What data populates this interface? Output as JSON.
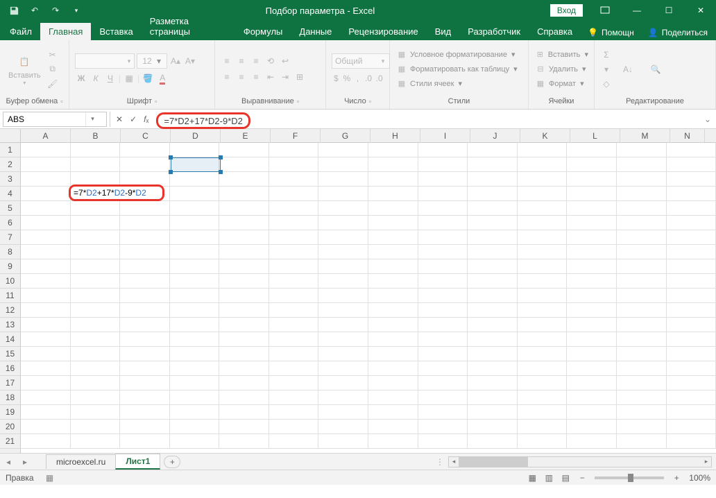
{
  "titlebar": {
    "title": "Подбор параметра - Excel",
    "login": "Вход"
  },
  "tabs": [
    "Файл",
    "Главная",
    "Вставка",
    "Разметка страницы",
    "Формулы",
    "Данные",
    "Рецензирование",
    "Вид",
    "Разработчик",
    "Справка"
  ],
  "active_tab_index": 1,
  "ribbon_right": {
    "tell": "Помощн",
    "share": "Поделиться"
  },
  "ribbon_groups": {
    "clipboard": {
      "paste": "Вставить",
      "label": "Буфер обмена"
    },
    "font": {
      "name": "",
      "size": "12",
      "label": "Шрифт",
      "buttons": [
        "Ж",
        "К",
        "Ч"
      ]
    },
    "alignment": {
      "label": "Выравнивание"
    },
    "number": {
      "format": "Общий",
      "label": "Число"
    },
    "styles": {
      "cond": "Условное форматирование",
      "table": "Форматировать как таблицу",
      "cell": "Стили ячеек",
      "label": "Стили"
    },
    "cells": {
      "insert": "Вставить",
      "delete": "Удалить",
      "format": "Формат",
      "label": "Ячейки"
    },
    "editing": {
      "label": "Редактирование"
    }
  },
  "namebox": "ABS",
  "formula": "=7*D2+17*D2-9*D2",
  "sheets": {
    "inactive": "microexcel.ru",
    "active": "Лист1"
  },
  "status": {
    "mode": "Правка",
    "zoom": "100%"
  },
  "columns": [
    "A",
    "B",
    "C",
    "D",
    "E",
    "F",
    "G",
    "H",
    "I",
    "J",
    "K",
    "L",
    "M",
    "N"
  ],
  "rows": [
    "1",
    "2",
    "3",
    "4",
    "5",
    "6",
    "7",
    "8",
    "9",
    "10",
    "11",
    "12",
    "13",
    "14",
    "15",
    "16",
    "17",
    "18",
    "19",
    "20",
    "21"
  ],
  "editcell_parts": {
    "eq": "=",
    "n1": "7*",
    "r1": "D2",
    "n2": "+17*",
    "r2": "D2",
    "n3": "-9*",
    "r3": "D2"
  }
}
